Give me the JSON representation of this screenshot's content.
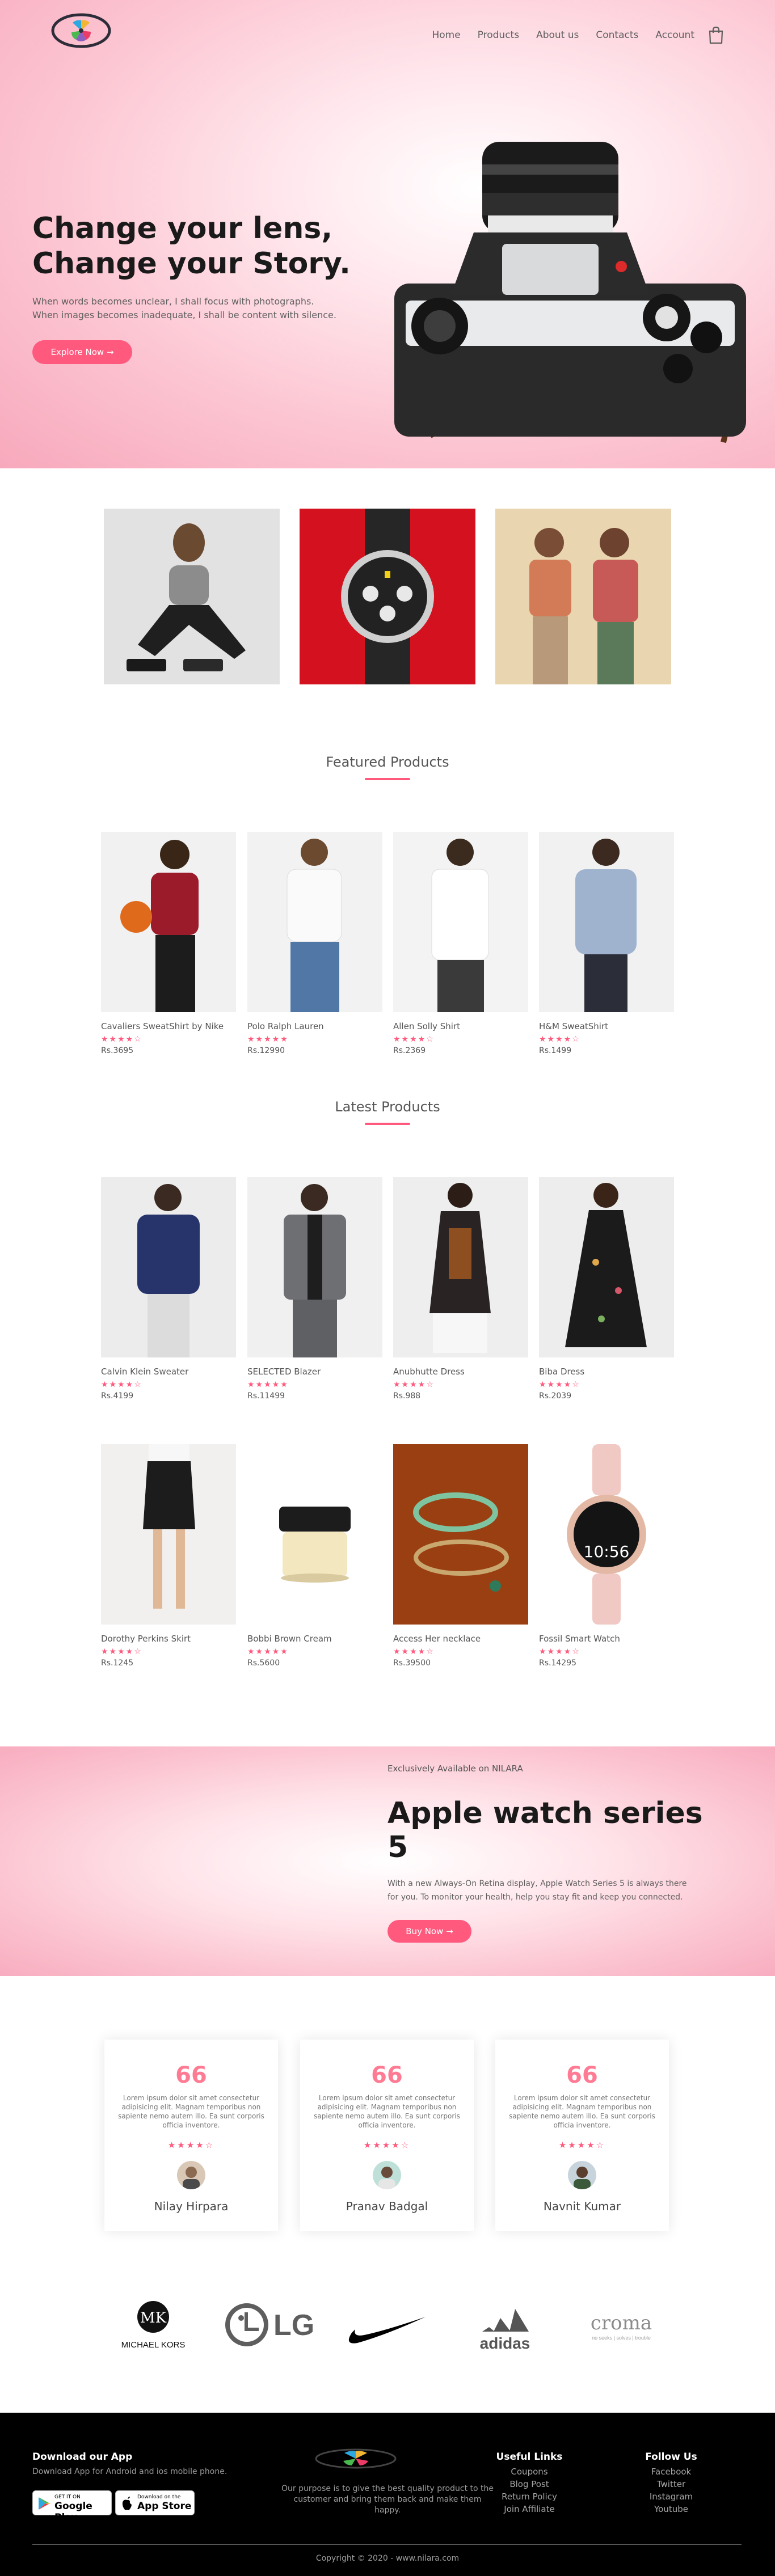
{
  "header": {
    "nav": [
      "Home",
      "Products",
      "About us",
      "Contacts",
      "Account"
    ]
  },
  "hero": {
    "title_line1": "Change your lens,",
    "title_line2": "Change your Story.",
    "text_line1": "When words becomes unclear, I shall focus with photographs.",
    "text_line2": "When images becomes inadequate, I shall be content with silence.",
    "button": "Explore Now →"
  },
  "featured": {
    "title": "Featured Products",
    "products": [
      {
        "name": "Cavaliers SweatShirt by Nike",
        "rating": "★★★★☆",
        "price": "Rs.3695"
      },
      {
        "name": "Polo Ralph Lauren",
        "rating": "★★★★★",
        "price": "Rs.12990"
      },
      {
        "name": "Allen Solly Shirt",
        "rating": "★★★★☆",
        "price": "Rs.2369"
      },
      {
        "name": "H&M SweatShirt",
        "rating": "★★★★☆",
        "price": "Rs.1499"
      }
    ]
  },
  "latest": {
    "title": "Latest Products",
    "products": [
      {
        "name": "Calvin Klein Sweater",
        "rating": "★★★★☆",
        "price": "Rs.4199"
      },
      {
        "name": "SELECTED Blazer",
        "rating": "★★★★★",
        "price": "Rs.11499"
      },
      {
        "name": "Anubhutte Dress",
        "rating": "★★★★☆",
        "price": "Rs.988"
      },
      {
        "name": "Biba Dress",
        "rating": "★★★★☆",
        "price": "Rs.2039"
      },
      {
        "name": "Dorothy Perkins Skirt",
        "rating": "★★★★☆",
        "price": "Rs.1245"
      },
      {
        "name": "Bobbi Brown Cream",
        "rating": "★★★★★",
        "price": "Rs.5600"
      },
      {
        "name": "Access Her necklace",
        "rating": "★★★★☆",
        "price": "Rs.39500"
      },
      {
        "name": "Fossil Smart Watch",
        "rating": "★★★★☆",
        "price": "Rs.14295"
      }
    ]
  },
  "offer": {
    "small": "Exclusively Available on NILARA",
    "title_line1": "Apple watch series",
    "title_line2": "5",
    "text_line1": "With a new Always-On Retina display, Apple Watch Series 5 is always there",
    "text_line2": "for you. To monitor your health, help you stay fit and keep you connected.",
    "button": "Buy Now →",
    "watch_time": "10:56"
  },
  "testimonials": {
    "quote_mark": "66",
    "text_lines": [
      "Lorem ipsum dolor sit amet consectetur",
      "adipisicing elit. Magnam temporibus non",
      "sapiente nemo autem illo. Ea sunt corporis",
      "officia inventore."
    ],
    "items": [
      {
        "name": "Nilay Hirpara",
        "rating": "★★★★☆"
      },
      {
        "name": "Pranav Badgal",
        "rating": "★★★★☆"
      },
      {
        "name": "Navnit Kumar",
        "rating": "★★★★☆"
      }
    ]
  },
  "brands": {
    "mk_text": "MICHAEL KORS",
    "lg_text": "LG",
    "adidas_text": "adidas",
    "croma_text": "croma",
    "croma_tag": "no seeks | solves | trouble"
  },
  "footer": {
    "app_title": "Download our App",
    "app_text": "Download App for Android and ios mobile phone.",
    "google_small": "GET IT ON",
    "google_big": "Google Play",
    "apple_small": "Download on the",
    "apple_big": "App Store",
    "purpose_line1": "Our purpose is to give the best quality product to the",
    "purpose_line2": "customer and bring them back and make them",
    "purpose_line3": "happy.",
    "useful_title": "Useful Links",
    "useful_links": [
      "Coupons",
      "Blog Post",
      "Return Policy",
      "Join Affiliate"
    ],
    "follow_title": "Follow Us",
    "follow_links": [
      "Facebook",
      "Twitter",
      "Instagram",
      "Youtube"
    ],
    "copyright": "Copyright © 2020 - www.nilara.com"
  },
  "colors": {
    "accent": "#ff5a7e",
    "hero_pink": "#f7a9bc",
    "footer_bg": "#000000"
  }
}
